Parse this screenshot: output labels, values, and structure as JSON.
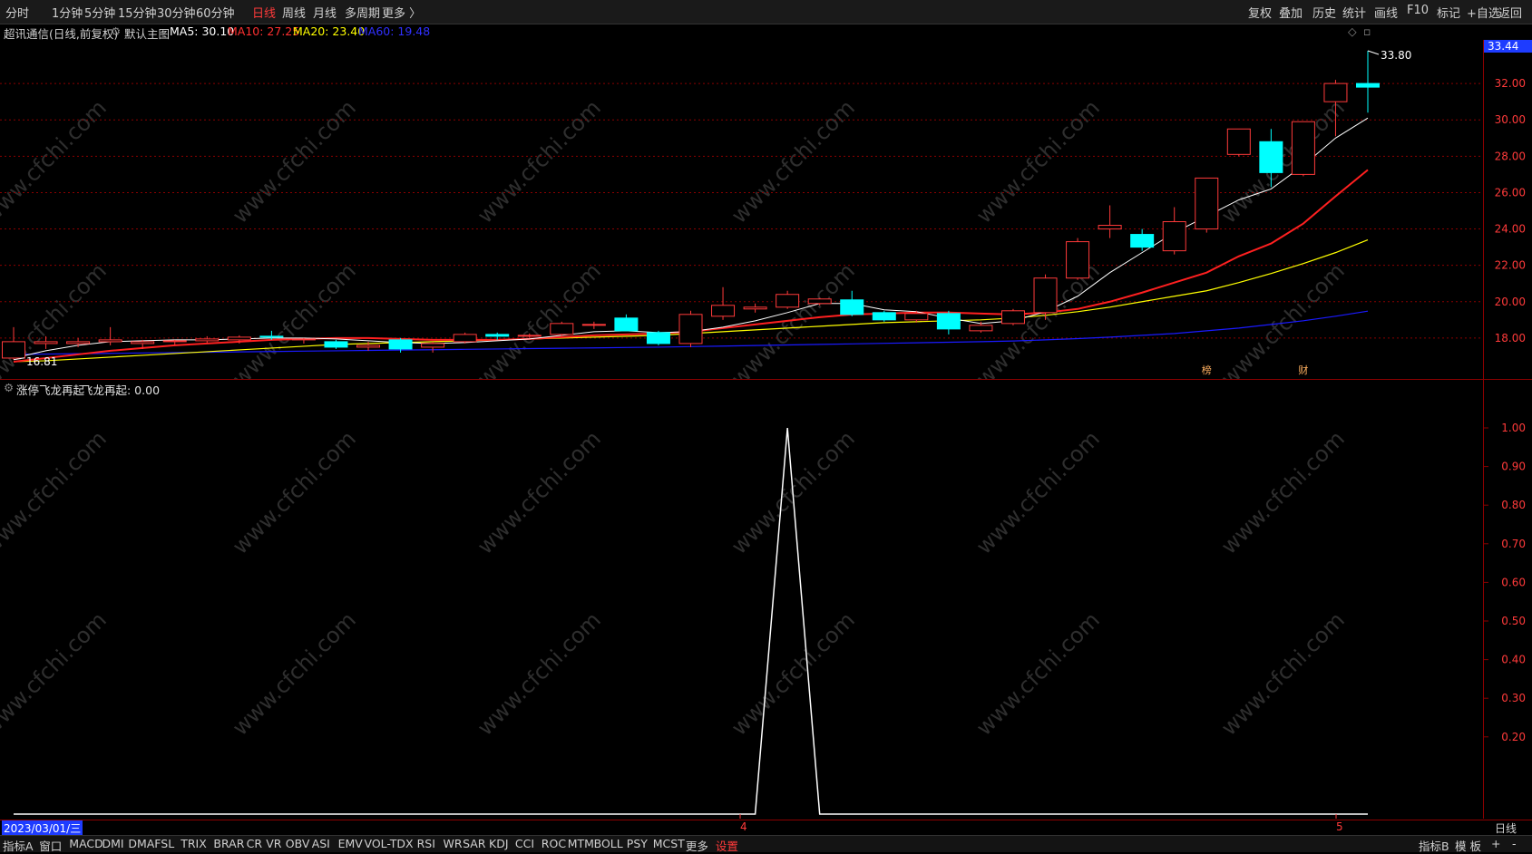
{
  "toolbar": {
    "periods": [
      "分时",
      "1分钟",
      "5分钟",
      "15分钟",
      "30分钟",
      "60分钟",
      "日线",
      "周线",
      "月线",
      "多周期",
      "更多 〉"
    ],
    "active_period": "日线",
    "right_buttons": [
      "复权",
      "叠加",
      "历史",
      "统计",
      "画线",
      "F10",
      "标记",
      "+自选",
      "返回"
    ]
  },
  "main_legend": {
    "stock_name": "超讯通信(日线,前复权)",
    "chart_name": "默认主图",
    "ma5": "MA5: 30.10",
    "ma10": "MA10: 27.25",
    "ma20": "MA20: 23.40",
    "ma60": "MA60: 19.48",
    "price_badge": "33.44",
    "high_label": "33.80",
    "low_label": "16.81",
    "marker_1": "榜",
    "marker_2": "财"
  },
  "sub_legend": {
    "indicator_name": "涨停飞龙再起",
    "value_label": "飞龙再起: 0.00"
  },
  "bottom": {
    "date_label": "2023/03/01/三",
    "month_4": "4",
    "month_5": "5",
    "right_label": "日线",
    "tabs": [
      "指标A",
      "窗口",
      "MACD",
      "DMI",
      "DMA",
      "FSL",
      "TRIX",
      "BRAR",
      "CR",
      "VR",
      "OBV",
      "ASI",
      "EMV",
      "VOL-TDX",
      "RSI",
      "WR",
      "SAR",
      "KDJ",
      "CCI",
      "ROC",
      "MTM",
      "BOLL",
      "PSY",
      "MCST",
      "更多",
      "设置"
    ],
    "active_tab": "设置",
    "right_tabs": [
      "指标B",
      "模 板",
      "+",
      "-"
    ]
  },
  "watermark": "www.cfchi.com",
  "colors": {
    "up": "#ff3a3a",
    "down": "#00ffff",
    "ma5": "#ffffff",
    "ma10": "#ff2020",
    "ma20": "#ffff00",
    "ma60": "#1a1aff",
    "grid": "#8b0000",
    "axis_text": "#ff3a3a"
  },
  "chart_data": [
    {
      "type": "candlestick",
      "title": "超讯通信(日线,前复权)",
      "y_axis_ticks": [
        18,
        20,
        22,
        24,
        26,
        28,
        30,
        32
      ],
      "ylim": [
        16.0,
        34.0
      ],
      "candles": [
        {
          "o": 16.9,
          "h": 18.6,
          "l": 16.81,
          "c": 17.8
        },
        {
          "o": 17.7,
          "h": 18.1,
          "l": 17.4,
          "c": 17.8
        },
        {
          "o": 17.7,
          "h": 18.0,
          "l": 17.5,
          "c": 17.8
        },
        {
          "o": 17.8,
          "h": 18.6,
          "l": 17.6,
          "c": 17.9
        },
        {
          "o": 17.7,
          "h": 17.9,
          "l": 17.4,
          "c": 17.8
        },
        {
          "o": 17.8,
          "h": 17.9,
          "l": 17.6,
          "c": 17.85
        },
        {
          "o": 17.85,
          "h": 18.1,
          "l": 17.7,
          "c": 17.95
        },
        {
          "o": 17.9,
          "h": 18.15,
          "l": 17.7,
          "c": 18.05
        },
        {
          "o": 18.1,
          "h": 18.4,
          "l": 17.9,
          "c": 18.05
        },
        {
          "o": 17.9,
          "h": 18.0,
          "l": 17.7,
          "c": 17.95
        },
        {
          "o": 17.8,
          "h": 17.9,
          "l": 17.4,
          "c": 17.5
        },
        {
          "o": 17.5,
          "h": 17.8,
          "l": 17.3,
          "c": 17.6
        },
        {
          "o": 17.9,
          "h": 18.0,
          "l": 17.2,
          "c": 17.4
        },
        {
          "o": 17.5,
          "h": 17.8,
          "l": 17.2,
          "c": 17.7
        },
        {
          "o": 17.8,
          "h": 18.3,
          "l": 17.7,
          "c": 18.2
        },
        {
          "o": 18.2,
          "h": 18.3,
          "l": 17.9,
          "c": 18.1
        },
        {
          "o": 18.1,
          "h": 18.25,
          "l": 18.0,
          "c": 18.15
        },
        {
          "o": 18.2,
          "h": 18.9,
          "l": 18.1,
          "c": 18.8
        },
        {
          "o": 18.7,
          "h": 18.9,
          "l": 18.5,
          "c": 18.75
        },
        {
          "o": 19.1,
          "h": 19.3,
          "l": 18.4,
          "c": 18.4
        },
        {
          "o": 18.3,
          "h": 18.4,
          "l": 17.6,
          "c": 17.7
        },
        {
          "o": 17.7,
          "h": 19.5,
          "l": 17.5,
          "c": 19.3
        },
        {
          "o": 19.2,
          "h": 20.8,
          "l": 19.0,
          "c": 19.8
        },
        {
          "o": 19.6,
          "h": 19.9,
          "l": 19.4,
          "c": 19.7
        },
        {
          "o": 19.7,
          "h": 20.6,
          "l": 19.6,
          "c": 20.4
        },
        {
          "o": 19.9,
          "h": 20.2,
          "l": 19.8,
          "c": 20.15
        },
        {
          "o": 20.1,
          "h": 20.6,
          "l": 19.2,
          "c": 19.3
        },
        {
          "o": 19.4,
          "h": 19.5,
          "l": 18.9,
          "c": 19.0
        },
        {
          "o": 19.0,
          "h": 19.5,
          "l": 18.85,
          "c": 19.35
        },
        {
          "o": 19.35,
          "h": 19.5,
          "l": 18.2,
          "c": 18.5
        },
        {
          "o": 18.4,
          "h": 18.9,
          "l": 18.3,
          "c": 18.7
        },
        {
          "o": 18.8,
          "h": 19.6,
          "l": 18.7,
          "c": 19.5
        },
        {
          "o": 19.4,
          "h": 21.5,
          "l": 19.0,
          "c": 21.3
        },
        {
          "o": 21.3,
          "h": 23.5,
          "l": 21.2,
          "c": 23.3
        },
        {
          "o": 24.0,
          "h": 25.3,
          "l": 23.5,
          "c": 24.2
        },
        {
          "o": 23.7,
          "h": 24.0,
          "l": 22.8,
          "c": 23.0
        },
        {
          "o": 22.8,
          "h": 25.2,
          "l": 22.6,
          "c": 24.4
        },
        {
          "o": 24.0,
          "h": 26.8,
          "l": 23.8,
          "c": 26.8
        },
        {
          "o": 28.1,
          "h": 29.5,
          "l": 28.0,
          "c": 29.5
        },
        {
          "o": 28.8,
          "h": 29.5,
          "l": 26.3,
          "c": 27.1
        },
        {
          "o": 27.0,
          "h": 29.9,
          "l": 26.9,
          "c": 29.9
        },
        {
          "o": 31.0,
          "h": 32.2,
          "l": 29.1,
          "c": 32.0
        },
        {
          "o": 32.0,
          "h": 33.8,
          "l": 30.4,
          "c": 31.8
        }
      ],
      "ma5_values": [
        16.9,
        17.3,
        17.6,
        17.8,
        17.85,
        17.9,
        17.9,
        17.95,
        18.0,
        18.0,
        17.95,
        17.85,
        17.75,
        17.7,
        17.75,
        17.85,
        17.95,
        18.15,
        18.35,
        18.4,
        18.3,
        18.35,
        18.6,
        18.95,
        19.4,
        19.9,
        19.9,
        19.55,
        19.45,
        19.1,
        18.8,
        18.95,
        19.45,
        20.3,
        21.6,
        22.7,
        23.8,
        24.7,
        25.6,
        26.2,
        27.5,
        29.0,
        30.1
      ],
      "ma10_values": [
        16.7,
        16.9,
        17.1,
        17.3,
        17.45,
        17.6,
        17.7,
        17.8,
        17.9,
        17.95,
        18.0,
        18.0,
        17.95,
        17.9,
        17.9,
        17.9,
        17.95,
        18.05,
        18.15,
        18.2,
        18.25,
        18.35,
        18.55,
        18.75,
        18.95,
        19.15,
        19.3,
        19.35,
        19.4,
        19.4,
        19.35,
        19.3,
        19.4,
        19.6,
        20.0,
        20.5,
        21.05,
        21.6,
        22.5,
        23.2,
        24.3,
        25.8,
        27.25
      ],
      "ma20_values": [
        16.7,
        16.75,
        16.85,
        16.95,
        17.05,
        17.15,
        17.25,
        17.35,
        17.45,
        17.55,
        17.65,
        17.7,
        17.75,
        17.8,
        17.85,
        17.9,
        17.95,
        18.0,
        18.05,
        18.1,
        18.15,
        18.25,
        18.35,
        18.45,
        18.55,
        18.65,
        18.75,
        18.85,
        18.9,
        18.95,
        19.0,
        19.1,
        19.25,
        19.45,
        19.7,
        20.0,
        20.3,
        20.6,
        21.05,
        21.55,
        22.1,
        22.7,
        23.4
      ],
      "ma60_values": [
        17.1,
        17.12,
        17.14,
        17.16,
        17.18,
        17.2,
        17.22,
        17.24,
        17.26,
        17.28,
        17.3,
        17.32,
        17.34,
        17.36,
        17.38,
        17.4,
        17.42,
        17.44,
        17.46,
        17.48,
        17.5,
        17.53,
        17.56,
        17.59,
        17.62,
        17.65,
        17.68,
        17.71,
        17.74,
        17.77,
        17.8,
        17.84,
        17.9,
        17.97,
        18.05,
        18.15,
        18.25,
        18.4,
        18.55,
        18.75,
        18.95,
        19.2,
        19.48
      ]
    },
    {
      "type": "line",
      "title": "涨停飞龙再起",
      "series": [
        {
          "name": "飞龙再起",
          "values": [
            0,
            0,
            0,
            0,
            0,
            0,
            0,
            0,
            0,
            0,
            0,
            0,
            0,
            0,
            0,
            0,
            0,
            0,
            0,
            0,
            0,
            0,
            0,
            0,
            1,
            0,
            0,
            0,
            0,
            0,
            0,
            0,
            0,
            0,
            0,
            0,
            0,
            0,
            0,
            0,
            0,
            0,
            0
          ]
        }
      ],
      "y_axis_ticks": [
        "1.00",
        "0.90",
        "0.80",
        "0.70",
        "0.60",
        "0.50",
        "0.40",
        "0.30",
        "0.20"
      ],
      "ylim": [
        0,
        1.0
      ]
    }
  ]
}
